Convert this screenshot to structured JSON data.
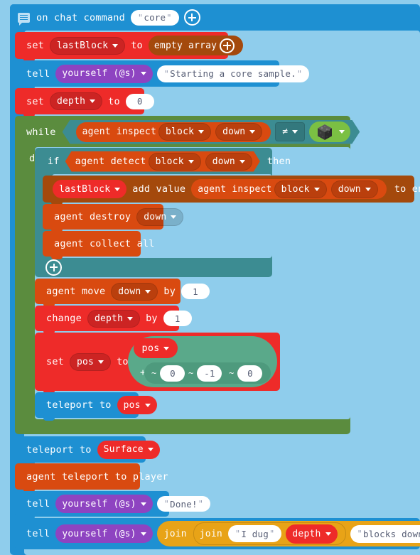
{
  "workspace": {
    "background_color": "#8FCDEC",
    "language": "MakeCode Minecraft Blocks"
  },
  "blocks": {
    "on_chat_command": {
      "icon": "chat-icon",
      "label": "on chat command",
      "command_value": "core",
      "plus_label": "+",
      "color": "#1E90D2"
    },
    "set_lastblock": {
      "set_label": "set",
      "variable": "lastBlock",
      "to_label": "to",
      "value_label": "empty array",
      "plus_label": "+",
      "color": "#EE2B29",
      "value_color": "#A4490C"
    },
    "tell_start": {
      "tell_label": "tell",
      "target": "yourself (@s)",
      "message": "Starting a core sample.",
      "color": "#1E90D2"
    },
    "set_depth": {
      "set_label": "set",
      "variable": "depth",
      "to_label": "to",
      "value": "0",
      "color": "#EE2B29"
    },
    "while_loop": {
      "while_label": "while",
      "do_label": "do",
      "color": "#5B8C3E",
      "condition": {
        "left": {
          "label": "agent inspect",
          "field_1": "block",
          "field_2": "down",
          "color": "#D94A10"
        },
        "operator": "≠",
        "right": {
          "icon": "minecraft-block-icon",
          "color": "#7BC043"
        },
        "color": "#3C8C92"
      }
    },
    "if_block": {
      "if_label": "if",
      "then_label": "then",
      "plus_label": "+",
      "color": "#3C8C92",
      "condition": {
        "label": "agent detect",
        "field_1": "block",
        "field_2": "down",
        "color": "#D94A10"
      }
    },
    "array_add": {
      "variable": "lastBlock",
      "label": "add value",
      "to_end_label": "to end",
      "color": "#A4490C",
      "value": {
        "label": "agent inspect",
        "field_1": "block",
        "field_2": "down",
        "color": "#D94A10"
      }
    },
    "agent_destroy": {
      "label": "agent destroy",
      "direction": "down",
      "color": "#D94A10"
    },
    "agent_collect": {
      "label": "agent collect all",
      "color": "#D94A10"
    },
    "agent_move": {
      "label": "agent move",
      "direction": "down",
      "by_label": "by",
      "value": "1",
      "color": "#D94A10"
    },
    "change_depth": {
      "change_label": "change",
      "variable": "depth",
      "by_label": "by",
      "value": "1",
      "color": "#EE2B29"
    },
    "set_pos": {
      "set_label": "set",
      "variable": "pos",
      "to_label": "to",
      "color": "#EE2B29",
      "value": {
        "base_variable": "pos",
        "operator": "+",
        "coords": [
          {
            "prefix": "~",
            "value": "0"
          },
          {
            "prefix": "~",
            "value": "-1"
          },
          {
            "prefix": "~",
            "value": "0"
          }
        ],
        "color": "#5AA98A"
      }
    },
    "teleport_pos": {
      "label": "teleport to",
      "target": "pos",
      "color": "#1E90D2",
      "target_color": "#EE2B29"
    },
    "teleport_surface": {
      "label": "teleport to",
      "target": "Surface",
      "color": "#1E90D2",
      "target_color": "#EE2B29"
    },
    "agent_teleport_player": {
      "label": "agent teleport to player",
      "color": "#D94A10"
    },
    "tell_done": {
      "tell_label": "tell",
      "target": "yourself (@s)",
      "message": "Done!",
      "color": "#1E90D2"
    },
    "tell_summary": {
      "tell_label": "tell",
      "target": "yourself (@s)",
      "color": "#1E90D2",
      "value": {
        "join_outer_label": "join",
        "join_inner_label": "join",
        "text_1": "I dug ",
        "variable": "depth",
        "text_2": " blocks down!",
        "color": "#E8A317"
      }
    }
  }
}
